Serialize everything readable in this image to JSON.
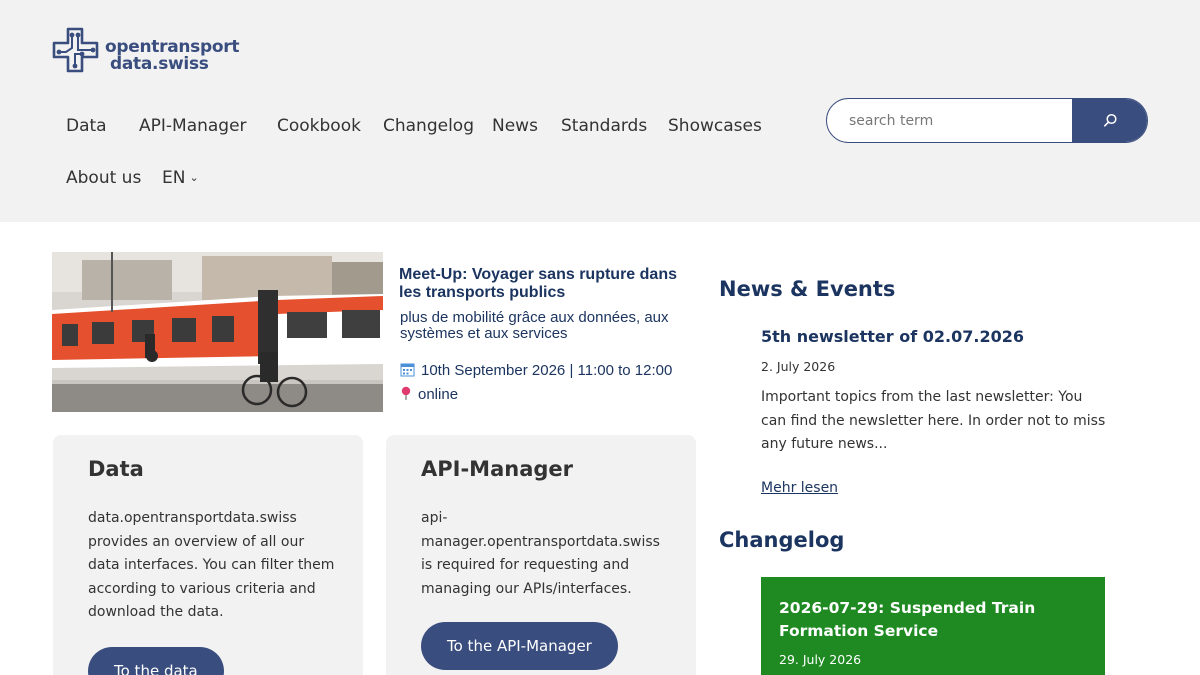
{
  "logo": {
    "line1": "opentransport",
    "line2": "data.swiss",
    "brand_color": "#3a4d7f"
  },
  "nav": {
    "items": [
      {
        "label": "Data"
      },
      {
        "label": "API-Manager"
      },
      {
        "label": "Cookbook"
      },
      {
        "label": "Changelog"
      },
      {
        "label": "News"
      },
      {
        "label": "Standards"
      },
      {
        "label": "Showcases"
      },
      {
        "label": "About us"
      }
    ],
    "language": "EN"
  },
  "search": {
    "placeholder": "search term",
    "icon": "search-icon"
  },
  "banner": {
    "title": "Meet-Up: Voyager sans rupture dans les transports publics",
    "subtitle": "plus de mobilité grâce aux données, aux systèmes et aux services",
    "date": "10th September 2026 | 11:00 to 12:00",
    "location": "online",
    "title_color": "#1c3560"
  },
  "cards": [
    {
      "title": "Data",
      "text": "data.opentransportdata.swiss provides an overview of all our data interfaces. You can filter them according to various criteria and download the data.",
      "button": "To the data"
    },
    {
      "title": "API-Manager",
      "text": "api-manager.opentransportdata.swiss is required for requesting and managing our APIs/interfaces.",
      "button": "To the API-Manager"
    }
  ],
  "news": {
    "section_title": "News & Events",
    "item": {
      "title": "5th newsletter of 02.07.2026",
      "date": "2. July 2026",
      "text": "Important topics from the last newsletter: You can find the newsletter here. In order not to miss any future news...",
      "link": "Mehr lesen"
    }
  },
  "changelog": {
    "section_title": "Changelog",
    "item": {
      "title": "2026-07-29: Suspended Train Formation Service",
      "date": "29. July 2026",
      "color": "#1f8a22"
    }
  }
}
